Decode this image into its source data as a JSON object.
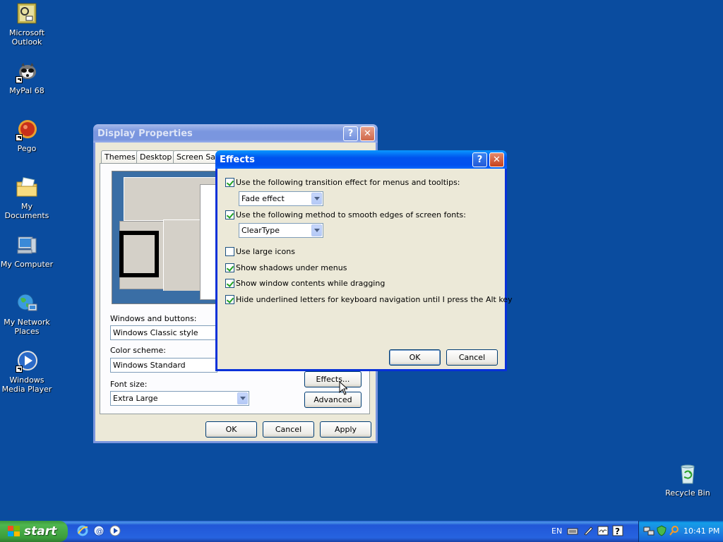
{
  "desktop": {
    "icons": [
      {
        "label": "Microsoft Outlook"
      },
      {
        "label": "MyPal 68"
      },
      {
        "label": "Pego"
      },
      {
        "label": "My Documents"
      },
      {
        "label": "My Computer"
      },
      {
        "label": "My Network Places"
      },
      {
        "label": "Windows Media Player"
      },
      {
        "label": "Recycle Bin"
      }
    ]
  },
  "display_properties": {
    "title": "Display Properties",
    "tabs": [
      "Themes",
      "Desktop",
      "Screen Sav"
    ],
    "windows_and_buttons_label": "Windows and buttons:",
    "windows_and_buttons_value": "Windows Classic style",
    "color_scheme_label": "Color scheme:",
    "color_scheme_value": "Windows Standard",
    "font_size_label": "Font size:",
    "font_size_value": "Extra Large",
    "effects_button": "Effects...",
    "advanced_button": "Advanced",
    "ok_button": "OK",
    "cancel_button": "Cancel",
    "apply_button": "Apply"
  },
  "effects": {
    "title": "Effects",
    "transition_label": "Use the following transition effect for menus and tooltips:",
    "transition_checked": true,
    "transition_value": "Fade effect",
    "smooth_label": "Use the following method to smooth edges of screen fonts:",
    "smooth_checked": true,
    "smooth_value": "ClearType",
    "large_icons_label": "Use large icons",
    "large_icons_checked": false,
    "shadows_label": "Show shadows under menus",
    "shadows_checked": true,
    "drag_label": "Show window contents while dragging",
    "drag_checked": true,
    "underline_label": "Hide underlined letters for keyboard navigation until I press the Alt key",
    "underline_checked": true,
    "ok_button": "OK",
    "cancel_button": "Cancel"
  },
  "taskbar": {
    "start_label": "start",
    "language": "EN",
    "clock": "10:41 PM"
  },
  "colors": {
    "desktop": "#0a4c9f",
    "title_active": "#0053ee",
    "title_inactive": "#7a96df",
    "window_face": "#ece9d8"
  }
}
